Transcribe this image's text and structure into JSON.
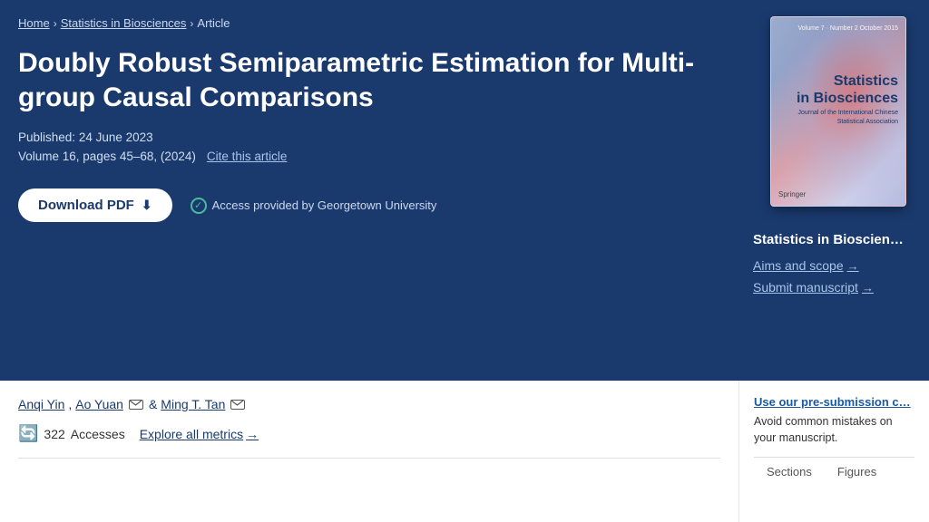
{
  "breadcrumb": {
    "home": "Home",
    "journal": "Statistics in Biosciences",
    "section": "Article"
  },
  "article": {
    "title": "Doubly Robust Semiparametric Estimation for Multi-group Causal Comparisons",
    "published_label": "Published:",
    "published_date": "24 June 2023",
    "volume_info": "Volume 16, pages 45–68, (2024)",
    "cite_label": "Cite this article"
  },
  "actions": {
    "download_pdf": "Download PDF",
    "access_text": "Access provided by Georgetown University"
  },
  "journal_cover": {
    "top_text": "Volume 7 · Number 2\nOctober 2015",
    "title_line1": "Statistics",
    "title_line2": "in Biosciences",
    "subtitle": "Journal of the\nInternational Chinese\nStatistical Association",
    "publisher": "Springer"
  },
  "sidebar": {
    "journal_title": "Statistics in Bioscien…",
    "aims_link": "Aims and scope",
    "submit_link": "Submit manuscript"
  },
  "authors": {
    "list": [
      {
        "name": "Anqi Yin",
        "has_email": false
      },
      {
        "name": "Ao Yuan",
        "has_email": true
      },
      {
        "name": "Ming T. Tan",
        "has_email": true
      }
    ],
    "separator": "&"
  },
  "metrics": {
    "icon": "📁",
    "accesses_count": "322",
    "accesses_label": "Accesses",
    "explore_link": "Explore all metrics",
    "explore_arrow": "→"
  },
  "presubmission": {
    "link_text": "Use our pre-submission c…",
    "body_text": "Avoid common mistakes on your manuscript."
  },
  "tabs": {
    "sections_label": "Sections",
    "figures_label": "Figures"
  }
}
